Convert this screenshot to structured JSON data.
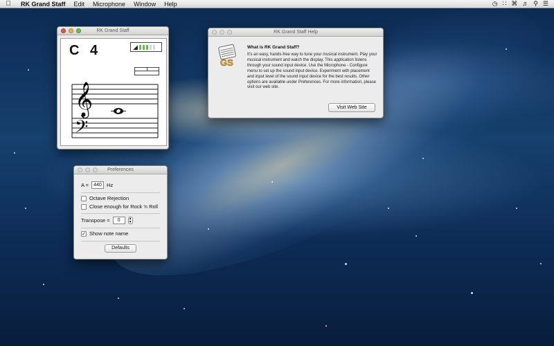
{
  "menubar": {
    "app_name": "RK Grand Staff",
    "items": [
      "Edit",
      "Microphone",
      "Window",
      "Help"
    ],
    "status_icons": [
      "time-machine-icon",
      "bluetooth-icon",
      "wifi-icon",
      "volume-icon",
      "spotlight-search-icon",
      "notification-center-icon"
    ]
  },
  "tuner_window": {
    "title": "RK Grand Staff",
    "note_letter": "C",
    "note_octave": "4",
    "level_meter_fraction": 0.6
  },
  "help_window": {
    "title": "RK Grand Staff Help",
    "heading": "What is RK Grand Staff?",
    "body": "It's an easy, hands-free way to tune your musical instrument. Play your musical instrument and watch the display. This application listens through your sound input device. Use the Microphone - Configure menu to set up the sound input device. Experiment with placement and input level of the sound input device for the best results. Other options are available under Preferences. For more information, please visit our web site.",
    "icon_text": "GS",
    "visit_button": "Visit Web Site"
  },
  "preferences_window": {
    "title": "Preferences",
    "a_label": "A =",
    "a_value": "440",
    "a_unit": "Hz",
    "octave_rejection_label": "Octave Rejection",
    "octave_rejection_checked": false,
    "close_enough_label": "Close enough for Rock 'n Roll",
    "close_enough_checked": false,
    "transpose_label": "Transpose =",
    "transpose_value": "0",
    "show_note_name_label": "Show note name",
    "show_note_name_checked": true,
    "defaults_button": "Defaults"
  },
  "colors": {
    "close": "#e0574d",
    "minimize": "#e5b33b",
    "zoom": "#6ac04b",
    "level_green": "#5cc24a"
  }
}
